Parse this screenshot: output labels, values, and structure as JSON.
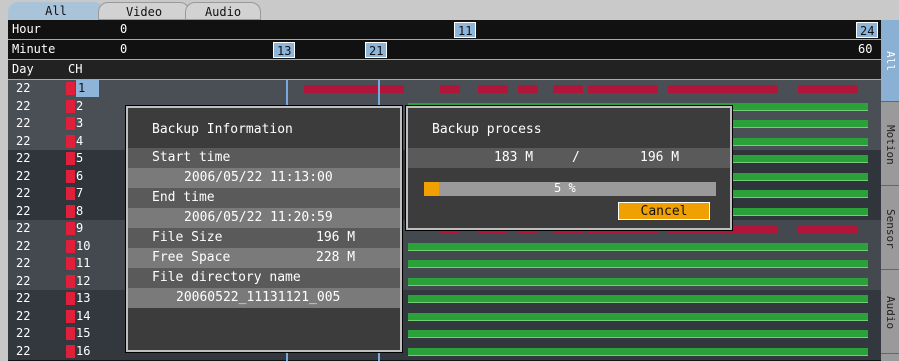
{
  "tabs": {
    "all": "All",
    "video": "Video",
    "audio": "Audio"
  },
  "header": {
    "hour_label": "Hour",
    "hour_start": "0",
    "hour_mid": "11",
    "hour_end": "24",
    "minute_label": "Minute",
    "minute_start": "0",
    "minute_end": "60",
    "minute_mark_a": "13",
    "minute_mark_b": "21",
    "day_label": "Day",
    "ch_label": "CH"
  },
  "side_tabs": [
    "All",
    "Motion",
    "Sensor",
    "Audio"
  ],
  "rows": [
    {
      "day": "22",
      "ch": "1"
    },
    {
      "day": "22",
      "ch": "2"
    },
    {
      "day": "22",
      "ch": "3"
    },
    {
      "day": "22",
      "ch": "4"
    },
    {
      "day": "22",
      "ch": "5"
    },
    {
      "day": "22",
      "ch": "6"
    },
    {
      "day": "22",
      "ch": "7"
    },
    {
      "day": "22",
      "ch": "8"
    },
    {
      "day": "22",
      "ch": "9"
    },
    {
      "day": "22",
      "ch": "10"
    },
    {
      "day": "22",
      "ch": "11"
    },
    {
      "day": "22",
      "ch": "12"
    },
    {
      "day": "22",
      "ch": "13"
    },
    {
      "day": "22",
      "ch": "14"
    },
    {
      "day": "22",
      "ch": "15"
    },
    {
      "day": "22",
      "ch": "16"
    }
  ],
  "backup_info": {
    "title": "Backup Information",
    "start_label": "Start time",
    "start_value": "2006/05/22  11:13:00",
    "end_label": "End time",
    "end_value": "2006/05/22  11:20:59",
    "size_label": "File Size",
    "size_value": "196 M",
    "free_label": "Free Space",
    "free_value": "228 M",
    "dir_label": "File directory name",
    "dir_value": "20060522_11131121_005"
  },
  "backup_process": {
    "title": "Backup process",
    "done": "183 M",
    "sep": "/",
    "total": "196 M",
    "percent_text": "5 %",
    "percent": 5,
    "cancel": "Cancel"
  },
  "colors": {
    "accent": "#8fb4da",
    "record": "#2ba13a",
    "event": "#b0163a",
    "button": "#f0a000"
  }
}
